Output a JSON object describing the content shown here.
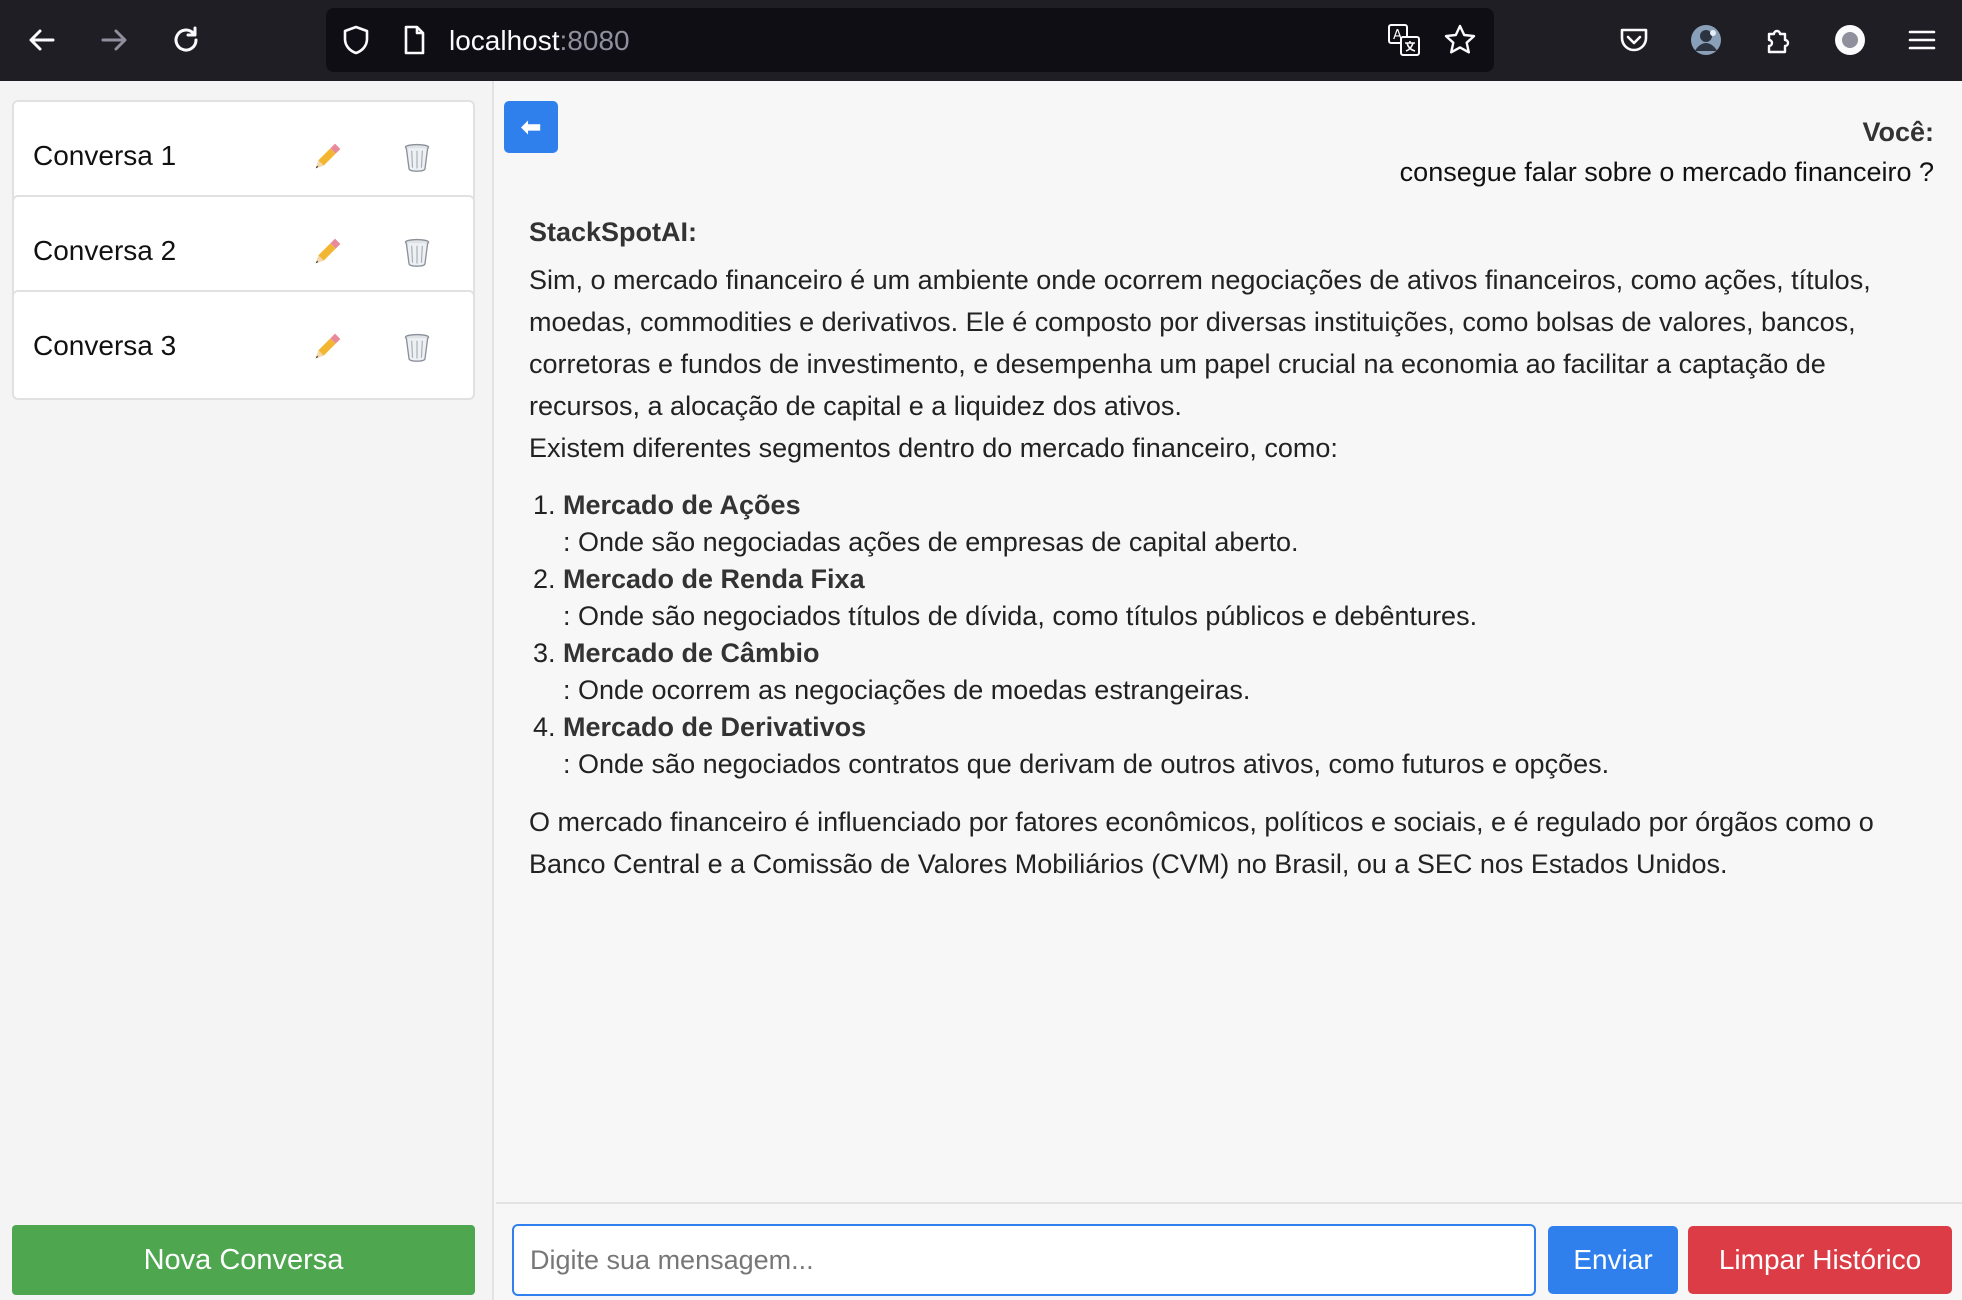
{
  "browser": {
    "url_host": "localhost",
    "url_port": ":8080"
  },
  "sidebar": {
    "conversations": [
      {
        "label": "Conversa 1"
      },
      {
        "label": "Conversa 2"
      },
      {
        "label": "Conversa 3"
      }
    ],
    "new_conversation_label": "Nova Conversa"
  },
  "chat": {
    "back_label": "⬅",
    "user": {
      "label": "Você:",
      "message": "consegue falar sobre o mercado financeiro ?"
    },
    "bot": {
      "label": "StackSpotAI:",
      "intro": "Sim, o mercado financeiro é um ambiente onde ocorrem negociações de ativos financeiros, como ações, títulos, moedas, commodities e derivativos. Ele é composto por diversas instituições, como bolsas de valores, bancos, corretoras e fundos de investimento, e desempenha um papel crucial na economia ao facilitar a captação de recursos, a alocação de capital e a liquidez dos ativos.",
      "segments_intro": "Existem diferentes segmentos dentro do mercado financeiro, como:",
      "segments": [
        {
          "term": "Mercado de Ações",
          "desc": ": Onde são negociadas ações de empresas de capital aberto."
        },
        {
          "term": "Mercado de Renda Fixa",
          "desc": ": Onde são negociados títulos de dívida, como títulos públicos e debêntures."
        },
        {
          "term": "Mercado de Câmbio",
          "desc": ": Onde ocorrem as negociações de moedas estrangeiras."
        },
        {
          "term": "Mercado de Derivativos",
          "desc": ": Onde são negociados contratos que derivam de outros ativos, como futuros e opções."
        }
      ],
      "conclusion": "O mercado financeiro é influenciado por fatores econômicos, políticos e sociais, e é regulado por órgãos como o Banco Central e a Comissão de Valores Mobiliários (CVM) no Brasil, ou a SEC nos Estados Unidos."
    }
  },
  "input": {
    "placeholder": "Digite sua mensagem...",
    "value": "",
    "send_label": "Enviar",
    "clear_label": "Limpar Histórico"
  },
  "colors": {
    "accent_blue": "#2f80ed",
    "new_conv_green": "#4ea64f",
    "clear_red": "#dc3c45",
    "browser_bg": "#1f1e25"
  },
  "icons": {
    "back": "arrow-left-icon",
    "forward": "arrow-right-icon",
    "reload": "reload-icon",
    "shield": "shield-icon",
    "page": "page-icon",
    "translate": "translate-icon",
    "bookmark": "star-icon",
    "pocket": "pocket-icon",
    "profile": "avatar",
    "extensions": "puzzle-icon",
    "record": "record-icon",
    "menu": "hamburger-menu-icon",
    "edit": "pencil-icon",
    "delete": "trash-icon"
  }
}
